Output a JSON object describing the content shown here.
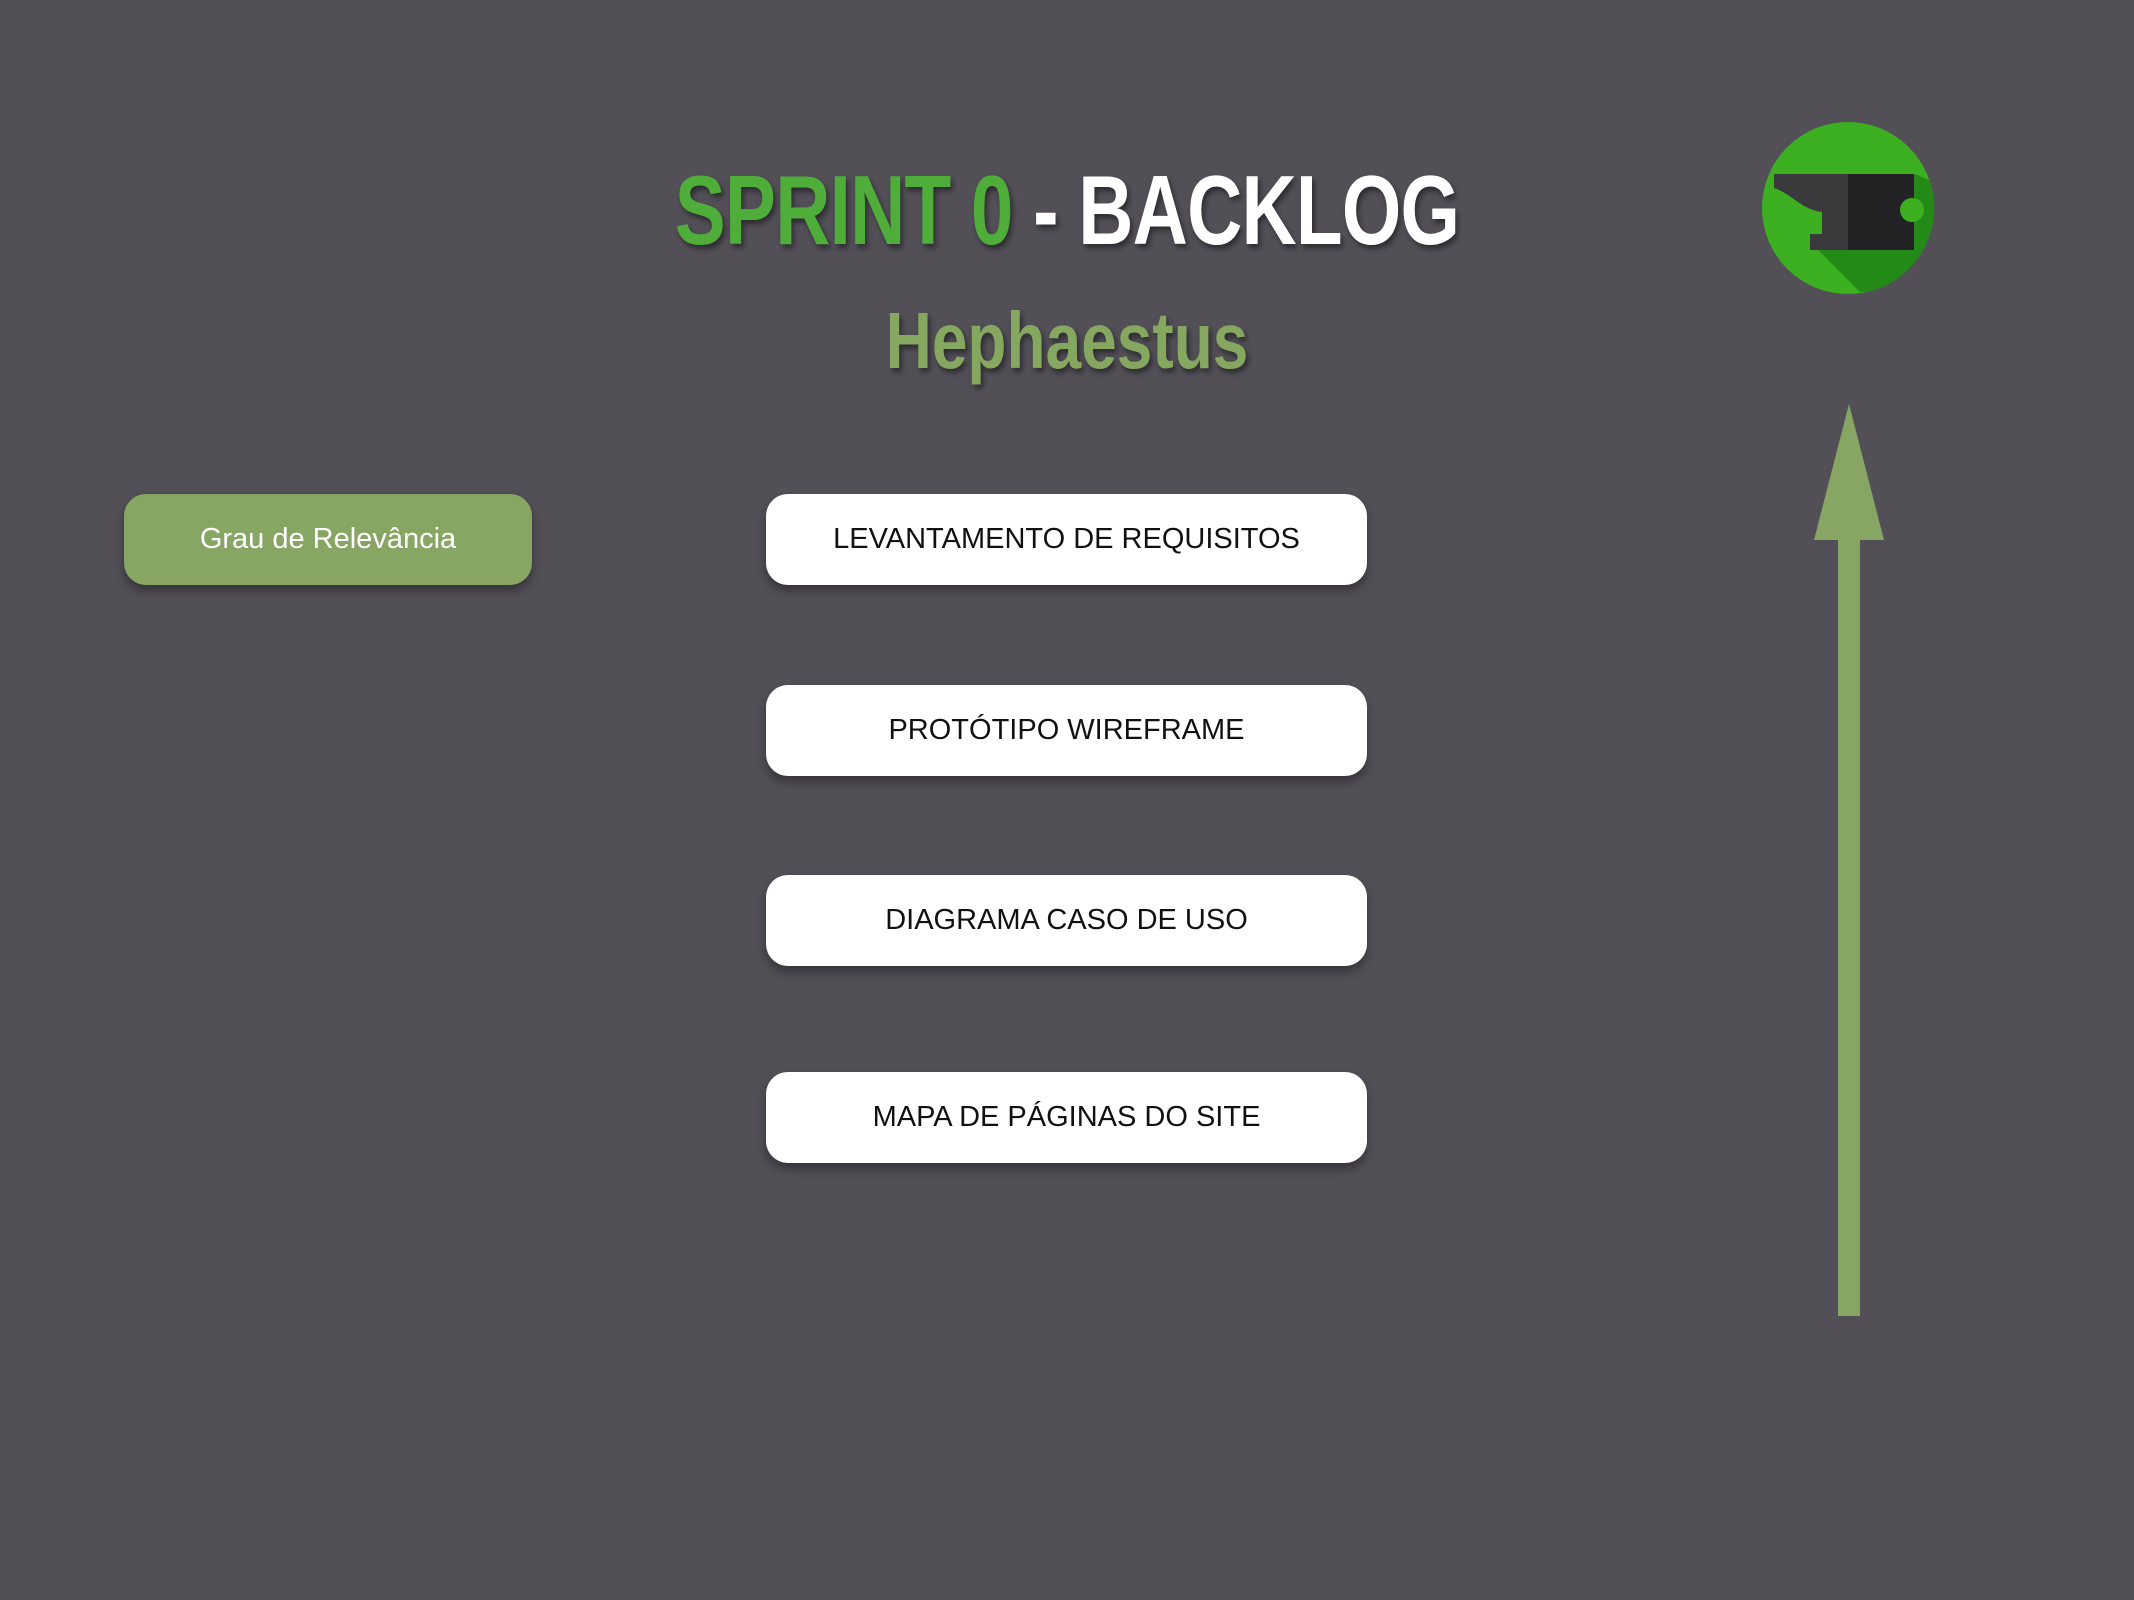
{
  "header": {
    "title_part1": "SPRINT 0",
    "title_part2": " - BACKLOG",
    "subtitle": "Hephaestus"
  },
  "relevance": {
    "label": "Grau de Relevância"
  },
  "backlog": {
    "items": [
      {
        "label": "LEVANTAMENTO DE REQUISITOS"
      },
      {
        "label": "PROTÓTIPO WIREFRAME"
      },
      {
        "label": "DIAGRAMA CASO DE USO"
      },
      {
        "label": "MAPA DE PÁGINAS DO SITE"
      }
    ]
  },
  "icons": {
    "logo": "anvil-logo-icon",
    "arrow": "arrow-up-icon"
  },
  "colors": {
    "background": "#524f57",
    "accent_green": "#4fae3a",
    "muted_green": "#87a663",
    "card": "#ffffff"
  }
}
